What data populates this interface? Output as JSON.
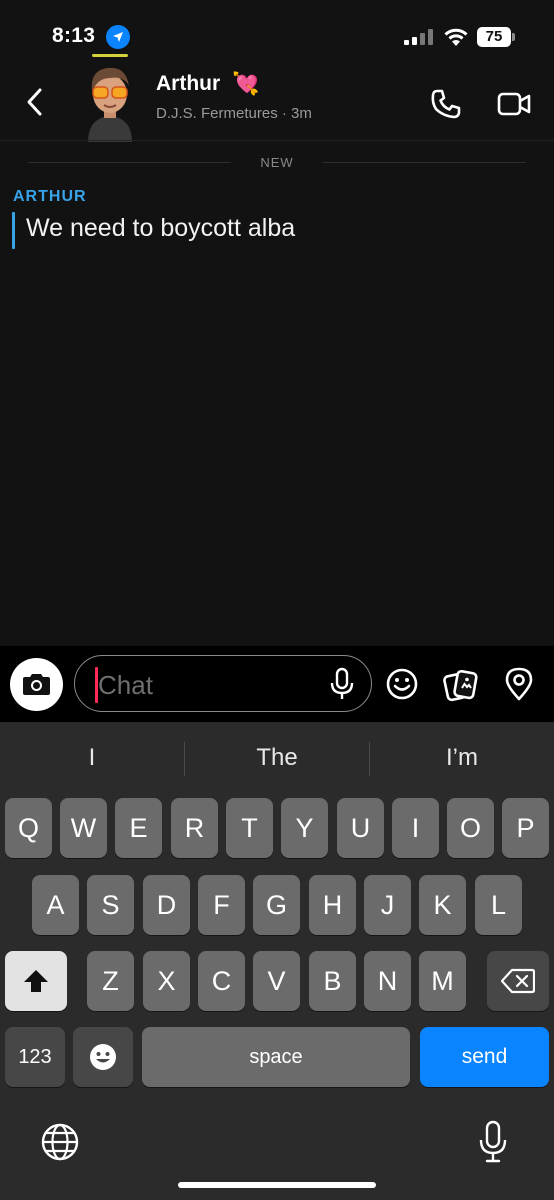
{
  "status_bar": {
    "time": "8:13",
    "battery": "75",
    "location_icon": "location-arrow-icon",
    "signal_icon": "cellular-signal-icon",
    "wifi_icon": "wifi-icon"
  },
  "header": {
    "name": "Arthur",
    "emoji": "💘",
    "subtitle": "D.J.S. Fermetures · 3m",
    "back_icon": "chevron-left-icon",
    "call_icon": "phone-icon",
    "video_icon": "video-camera-icon"
  },
  "chat": {
    "divider_label": "NEW",
    "messages": [
      {
        "sender": "ARTHUR",
        "text": "We need to boycott alba"
      }
    ]
  },
  "input_bar": {
    "placeholder": "Chat",
    "value": "",
    "camera_icon": "camera-icon",
    "mic_icon": "microphone-icon",
    "emoji_icon": "smiley-icon",
    "gallery_icon": "memories-icon",
    "location_icon": "location-pin-icon"
  },
  "keyboard": {
    "suggestions": [
      "I",
      "The",
      "I’m"
    ],
    "row1": [
      "Q",
      "W",
      "E",
      "R",
      "T",
      "Y",
      "U",
      "I",
      "O",
      "P"
    ],
    "row2": [
      "A",
      "S",
      "D",
      "F",
      "G",
      "H",
      "J",
      "K",
      "L"
    ],
    "row3": [
      "Z",
      "X",
      "C",
      "V",
      "B",
      "N",
      "M"
    ],
    "numbers_label": "123",
    "space_label": "space",
    "send_label": "send",
    "shift_icon": "shift-icon",
    "delete_icon": "backspace-icon",
    "emoji_icon": "emoji-icon",
    "globe_icon": "globe-icon",
    "dictation_icon": "microphone-icon"
  },
  "colors": {
    "accent": "#38a3e8",
    "send": "#0a84ff",
    "cursor": "#ff2a55",
    "background": "#121212"
  }
}
